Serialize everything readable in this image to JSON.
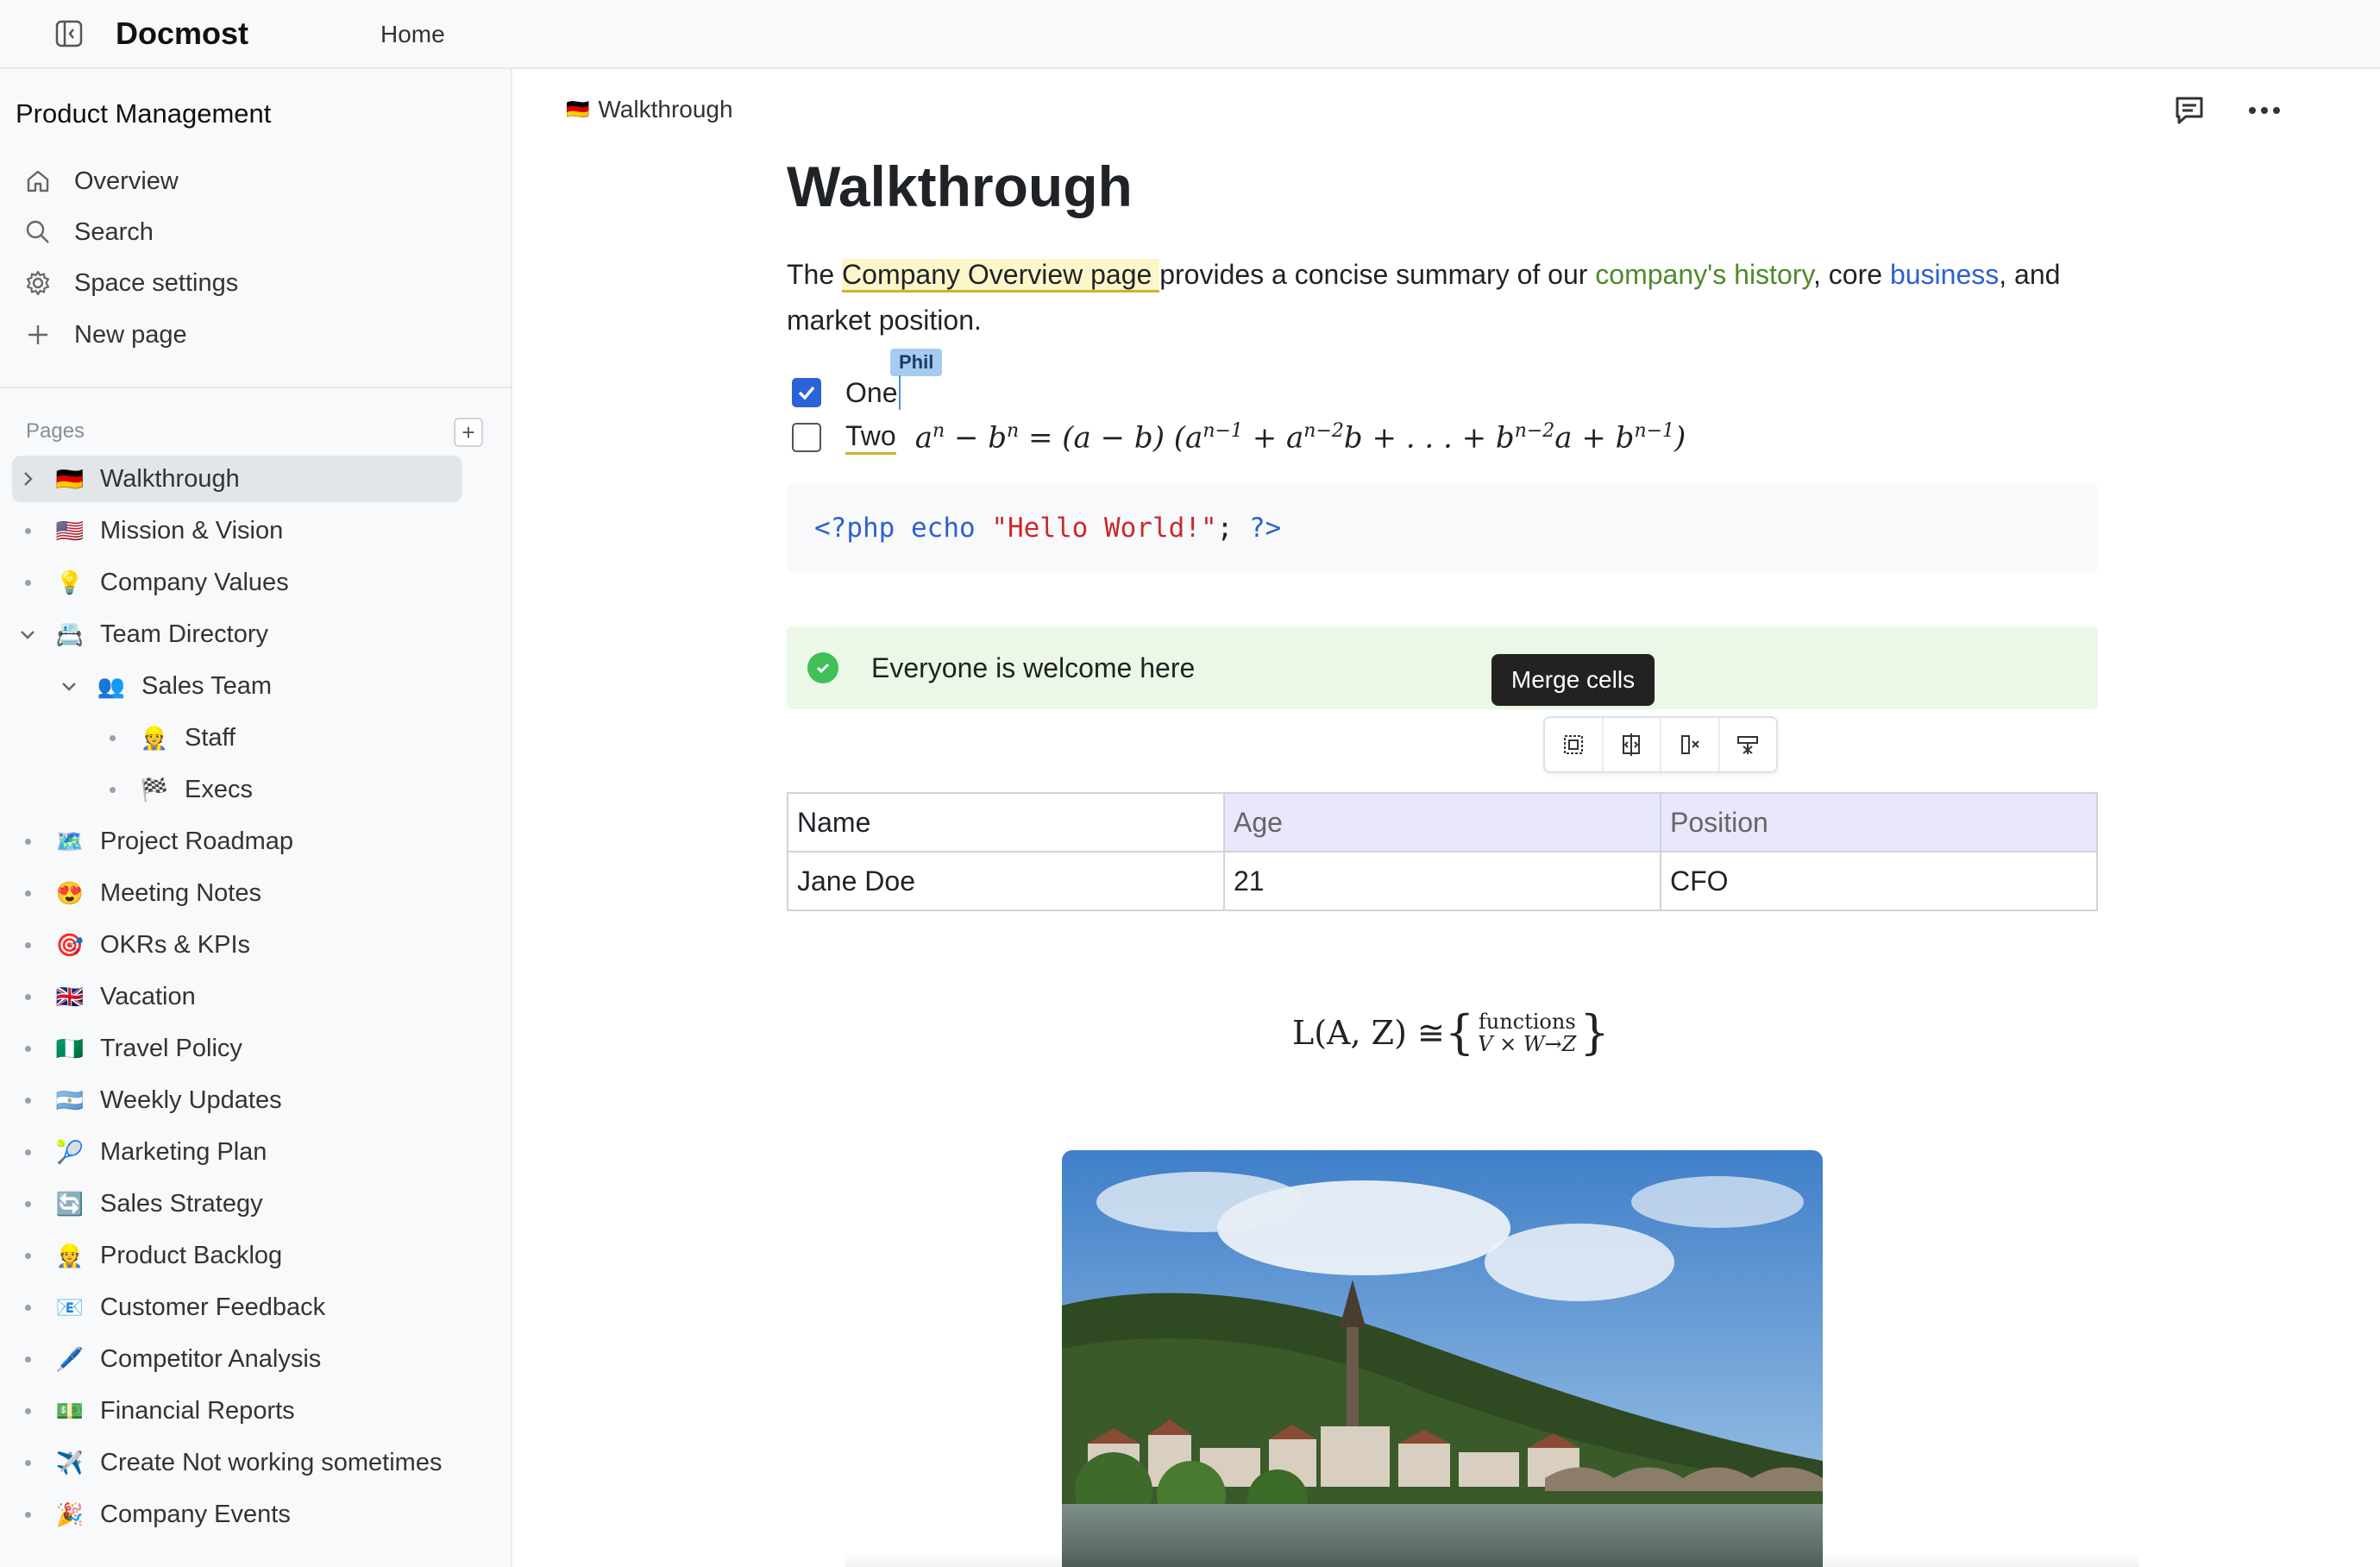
{
  "header": {
    "brand": "Docmost",
    "home_link": "Home"
  },
  "sidebar": {
    "space_name": "Product Management",
    "menu": [
      {
        "label": "Overview",
        "icon": "home-icon"
      },
      {
        "label": "Search",
        "icon": "search-icon"
      },
      {
        "label": "Space settings",
        "icon": "gear-icon"
      },
      {
        "label": "New page",
        "icon": "plus-icon"
      }
    ],
    "pages_label": "Pages",
    "add_page_symbol": "+",
    "pages": [
      {
        "label": "Walkthrough",
        "emoji": "🇩🇪",
        "control": "chevron-right",
        "active": true
      },
      {
        "label": "Mission & Vision",
        "emoji": "🇺🇸",
        "control": "dot"
      },
      {
        "label": "Company Values",
        "emoji": "💡",
        "control": "dot"
      },
      {
        "label": "Team Directory",
        "emoji": "📇",
        "control": "chevron-down"
      },
      {
        "label": "Sales Team",
        "emoji": "👥",
        "control": "chevron-down"
      },
      {
        "label": "Staff",
        "emoji": "👷",
        "control": "dot"
      },
      {
        "label": "Execs",
        "emoji": "🏁",
        "control": "dot"
      },
      {
        "label": "Project Roadmap",
        "emoji": "🗺️",
        "control": "dot"
      },
      {
        "label": "Meeting Notes",
        "emoji": "😍",
        "control": "dot"
      },
      {
        "label": "OKRs & KPIs",
        "emoji": "🎯",
        "control": "dot"
      },
      {
        "label": "Vacation",
        "emoji": "🇬🇧",
        "control": "dot"
      },
      {
        "label": "Travel Policy",
        "emoji": "🇳🇬",
        "control": "dot"
      },
      {
        "label": "Weekly Updates",
        "emoji": "🇦🇷",
        "control": "dot"
      },
      {
        "label": "Marketing Plan",
        "emoji": "🎾",
        "control": "dot"
      },
      {
        "label": "Sales Strategy",
        "emoji": "🔄",
        "control": "dot"
      },
      {
        "label": "Product Backlog",
        "emoji": "👷",
        "control": "dot"
      },
      {
        "label": "Customer Feedback",
        "emoji": "📧",
        "control": "dot"
      },
      {
        "label": "Competitor Analysis",
        "emoji": "🖊️",
        "control": "dot"
      },
      {
        "label": "Financial Reports",
        "emoji": "💵",
        "control": "dot"
      },
      {
        "label": "Create Not working sometimes",
        "emoji": "✈️",
        "control": "dot"
      },
      {
        "label": "Company Events",
        "emoji": "🎉",
        "control": "dot"
      }
    ]
  },
  "breadcrumb": {
    "emoji": "🇩🇪",
    "label": "Walkthrough"
  },
  "document": {
    "title": "Walkthrough",
    "paragraph": {
      "text_1": "The ",
      "highlight": "Company Overview page ",
      "text_2": "provides a concise summary of our ",
      "green_link": "company's history",
      "text_3": ", core ",
      "blue_link": "business",
      "text_4": ", and market position."
    },
    "tasks": [
      {
        "label": "One",
        "checked": true
      },
      {
        "label": "Two",
        "checked": false
      }
    ],
    "collaborator_cursor": "Phil",
    "code": {
      "open_tag": "<?php",
      "keyword": "echo",
      "string": "\"Hello World!\"",
      "semicolon": ";",
      "close_tag": "?>"
    },
    "callout": "Everyone is welcome here",
    "tooltip": "Merge cells",
    "table": {
      "rows": [
        [
          "Name",
          "Age",
          "Position"
        ],
        [
          "Jane Doe",
          "21",
          "CFO"
        ]
      ]
    },
    "formula": {
      "lhs": "L(A, Z) ≅",
      "numerator": "functions",
      "denominator": "V × W→Z"
    }
  },
  "colors": {
    "accent_blue": "#2b62d9",
    "callout_green": "#ebf8e7",
    "success_green": "#40c057",
    "selected_cell": "#e8e7fb",
    "highlight_yellow": "#fdf6c9"
  }
}
